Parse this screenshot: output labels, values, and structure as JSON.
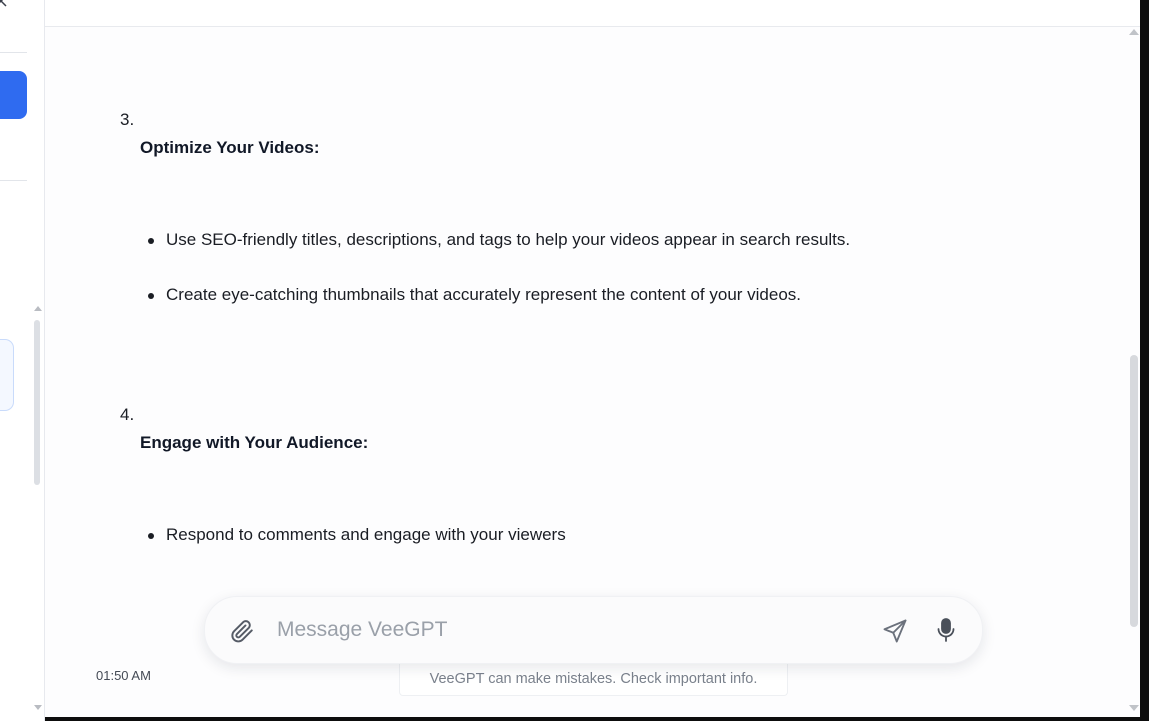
{
  "sidebar": {
    "close_icon": "close-icon"
  },
  "steps": [
    {
      "number": "3.",
      "title": "Optimize Your Videos:",
      "bullets": [
        "Use SEO-friendly titles, descriptions, and tags to help your videos appear in search results.",
        "Create eye-catching thumbnails that accurately represent the content of your videos."
      ]
    },
    {
      "number": "4.",
      "title": "Engage with Your Audience:",
      "bullets": [
        "Respond to comments and engage with your viewers"
      ]
    }
  ],
  "message": {
    "timestamp": "01:50 AM"
  },
  "composer": {
    "placeholder": "Message VeeGPT",
    "value": "",
    "icons": [
      "paperclip-icon",
      "send-icon",
      "microphone-icon"
    ]
  },
  "disclaimer": "VeeGPT can make mistakes. Check important info.",
  "colors": {
    "accent": "#2f6bf0",
    "text": "#1a1d24",
    "muted": "#7a818c",
    "placeholder": "#9aa0a9"
  }
}
